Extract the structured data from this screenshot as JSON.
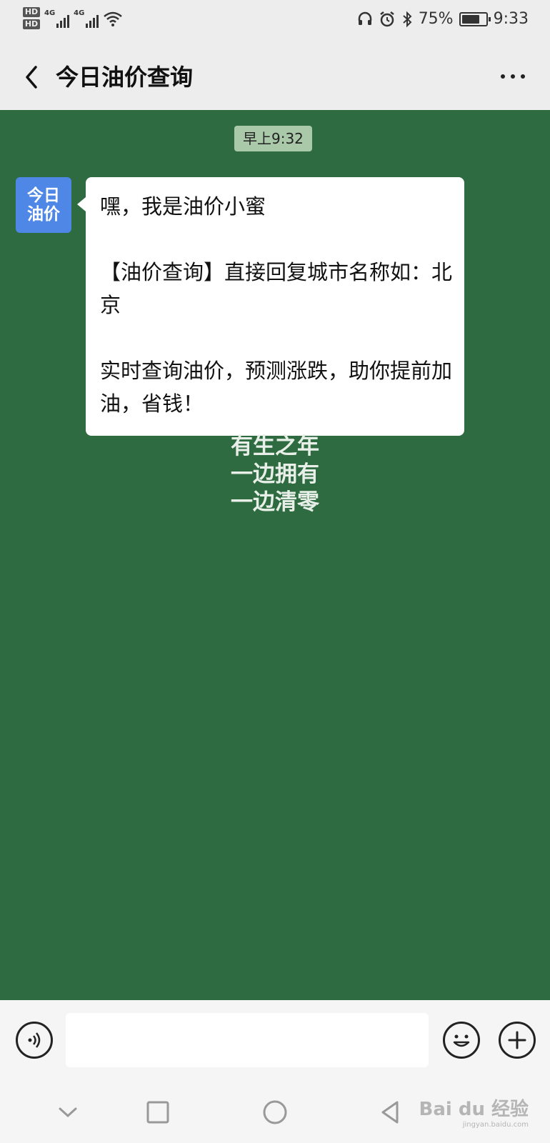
{
  "status_bar": {
    "hd1": "HD",
    "hd2": "HD",
    "net1": "4G",
    "net2": "4G",
    "battery_percent": "75%",
    "battery_level": 0.75,
    "time": "9:33",
    "icons": [
      "headphones-icon",
      "alarm-icon",
      "bluetooth-icon",
      "wifi-icon",
      "battery-icon"
    ]
  },
  "title_bar": {
    "title": "今日油价查询",
    "back_icon": "chevron-left-icon",
    "more_icon": "more-dots-icon"
  },
  "chat": {
    "timestamp": "早上9:32",
    "avatar": {
      "line1": "今日",
      "line2": "油价",
      "color": "#4f87e6"
    },
    "message": {
      "line1": "嘿，我是油价小蜜",
      "line2": "【油价查询】直接回复城市名称如：北京",
      "line3": "实时查询油价，预测涨跌，助你提前加油，省钱！"
    },
    "wallpaper_text": {
      "line1": "有生之年",
      "line2": "一边拥有",
      "line3": "一边清零"
    },
    "background_color": "#2e6b41"
  },
  "input_bar": {
    "voice_icon": "voice-icon",
    "input_value": "",
    "emoji_icon": "emoji-icon",
    "plus_icon": "plus-icon"
  },
  "nav_bar": {
    "icons": [
      "chevron-down-icon",
      "square-icon",
      "circle-icon",
      "triangle-back-icon"
    ],
    "watermark_main": "Bai du 经验",
    "watermark_sub": "jingyan.baidu.com"
  }
}
